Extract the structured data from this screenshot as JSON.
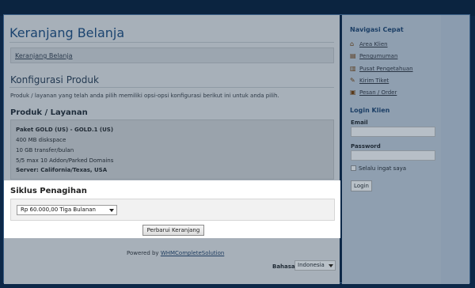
{
  "page": {
    "title": "Keranjang Belanja",
    "breadcrumb": "Keranjang Belanja",
    "section_title": "Konfigurasi Produk",
    "intro": "Produk / layanan yang telah anda pilih memiliki opsi-opsi konfigurasi berikut ini untuk anda pilih.",
    "product_heading": "Produk / Layanan"
  },
  "product": {
    "name": "Paket GOLD (US) - GOLD.1 (US)",
    "lines": [
      "400 MB diskspace",
      "10 GB transfer/bulan",
      "5/5 max 10 Addon/Parked Domains"
    ],
    "server": "Server: California/Texas, USA"
  },
  "billing": {
    "heading": "Siklus Penagihan",
    "selected": "Rp 60.000,00 Tiga Bulanan",
    "update_label": "Perbarui Keranjang"
  },
  "footer": {
    "powered_prefix": "Powered by",
    "powered_link": "WHMCompleteSolution",
    "lang_label": "Bahasa:",
    "lang_selected": "Indonesia"
  },
  "sidebar": {
    "nav_heading": "Navigasi Cepat",
    "nav_items": [
      {
        "label": "Area Klien",
        "icon": "home-icon"
      },
      {
        "label": "Pengumuman",
        "icon": "announcement-icon"
      },
      {
        "label": "Pusat Pengetahuan",
        "icon": "book-icon"
      },
      {
        "label": "Kirim Tiket",
        "icon": "ticket-icon"
      },
      {
        "label": "Pesan / Order",
        "icon": "cart-icon"
      }
    ],
    "login_heading": "Login Klien",
    "email_label": "Email",
    "password_label": "Password",
    "remember_label": "Selalu ingat saya",
    "login_button": "Login"
  }
}
